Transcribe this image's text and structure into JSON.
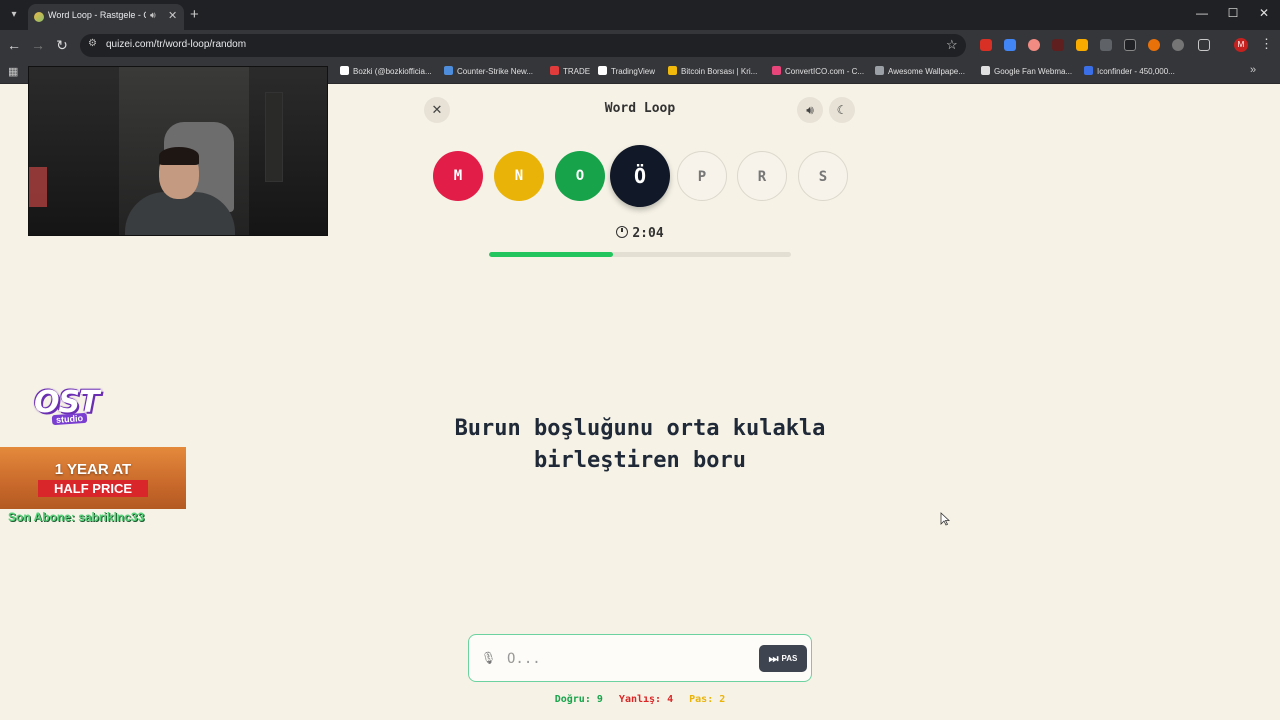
{
  "browser": {
    "tab": {
      "title": "Word Loop - Rastgele - Qu",
      "audio_icon": "speaker-icon",
      "close_icon": "close-icon"
    },
    "url": "quizei.com/tr/word-loop/random",
    "bookmarks": [
      {
        "label": "Bozki (@bozkiofficia...",
        "color": "#ffffff"
      },
      {
        "label": "Counter-Strike New...",
        "color": "#4e8ddb"
      },
      {
        "label": "TRADE",
        "color": "#e23b3b"
      },
      {
        "label": "TradingView",
        "color": "#ffffff"
      },
      {
        "label": "Bitcoin Borsası | Kri...",
        "color": "#f0b90b"
      },
      {
        "label": "ConvertICO.com - C...",
        "color": "#e8457a"
      },
      {
        "label": "Awesome Wallpape...",
        "color": "#9aa0a6"
      },
      {
        "label": "Google Fan Webma...",
        "color": "#e0e0e0"
      },
      {
        "label": "Iconfinder - 450,000...",
        "color": "#3b6fe8"
      }
    ],
    "profile_initial": "M"
  },
  "overlay": {
    "logo_main": "OST",
    "logo_sub": "studio",
    "promo_line1": "1 YEAR AT",
    "promo_line2": "HALF PRICE",
    "last_subscriber": "Son Abone: sabriklnc33"
  },
  "game": {
    "title": "Word Loop",
    "letters": [
      {
        "char": "M",
        "state": "done",
        "color": "#e11d48"
      },
      {
        "char": "N",
        "state": "done",
        "color": "#eab308"
      },
      {
        "char": "O",
        "state": "done",
        "color": "#16a34a"
      },
      {
        "char": "Ö",
        "state": "current",
        "color": "#111827"
      },
      {
        "char": "P",
        "state": "pending",
        "color": "#f7f3ea"
      },
      {
        "char": "R",
        "state": "pending",
        "color": "#f7f3ea"
      },
      {
        "char": "S",
        "state": "pending",
        "color": "#f7f3ea"
      }
    ],
    "timer": "2:04",
    "progress_fraction": 0.41,
    "clue_line1": "Burun boşluğunu orta kulakla",
    "clue_line2": "birleştiren boru",
    "input_placeholder": "Ö...",
    "input_value": "",
    "pass_label": "PAS",
    "stats": {
      "correct": "Doğru: 9",
      "wrong": "Yanlış: 4",
      "pass": "Pas: 2"
    },
    "colors": {
      "correct": "#16a34a",
      "wrong": "#dc2626",
      "pass": "#eab308",
      "progress": "#22c55e"
    }
  }
}
